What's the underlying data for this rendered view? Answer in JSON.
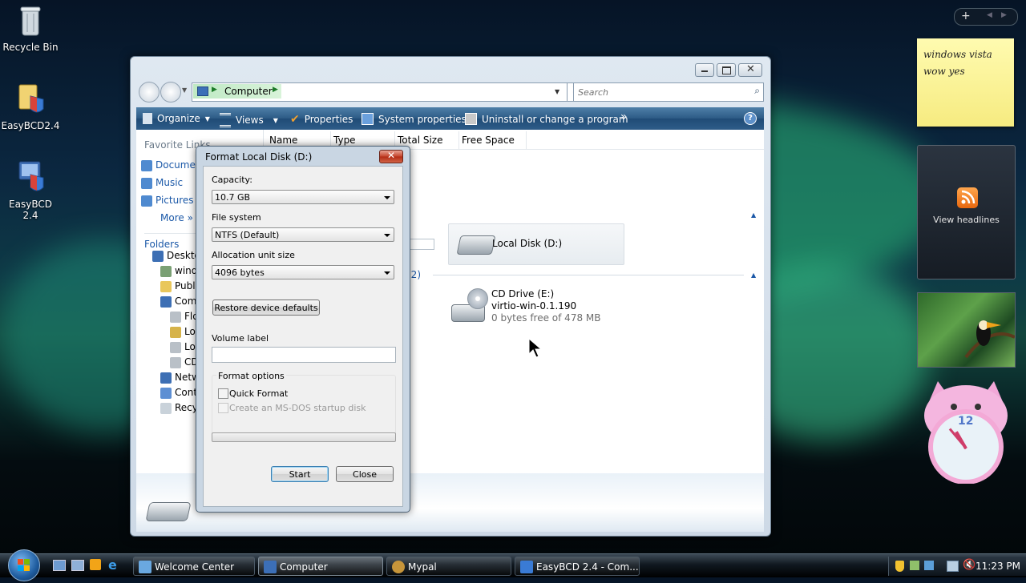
{
  "desktop": {
    "icons": [
      {
        "label": "Recycle Bin"
      },
      {
        "label": "EasyBCD2.4"
      },
      {
        "label": "EasyBCD 2.4"
      }
    ]
  },
  "explorer": {
    "breadcrumb": "Computer",
    "search_placeholder": "Search",
    "toolbar": {
      "organize": "Organize",
      "views": "Views",
      "properties": "Properties",
      "system_properties": "System properties",
      "uninstall": "Uninstall or change a program",
      "more": "»"
    },
    "columns": {
      "name": "Name",
      "type": "Type",
      "total_size": "Total Size",
      "free_space": "Free Space"
    },
    "nav": {
      "favorite_links": "Favorite Links",
      "documents": "Documents",
      "music": "Music",
      "pictures": "Pictures",
      "more": "More",
      "folders": "Folders"
    },
    "tree": [
      "Desktop",
      "windows",
      "Public",
      "Computer",
      "Floppy",
      "Local",
      "Local",
      "CD",
      "Network",
      "Control",
      "Recycle"
    ],
    "group_removable": "(2)",
    "drives": {
      "local_disk": "Local Disk (D:)",
      "cd_name": "CD Drive (E:)",
      "cd_label": "virtio-win-0.1.190",
      "cd_free": "0 bytes free of 478 MB"
    }
  },
  "dialog": {
    "title": "Format Local Disk (D:)",
    "capacity_label": "Capacity:",
    "capacity_value": "10.7 GB",
    "filesystem_label": "File system",
    "filesystem_value": "NTFS (Default)",
    "allocation_label": "Allocation unit size",
    "allocation_value": "4096 bytes",
    "restore_button": "Restore device defaults",
    "volume_label": "Volume label",
    "volume_value": "",
    "format_options": "Format options",
    "quick_format": "Quick Format",
    "quick_format_checked": false,
    "msdos_disk": "Create an MS-DOS startup disk",
    "msdos_checked": false,
    "progress": 0,
    "start_button": "Start",
    "close_button": "Close"
  },
  "gadgets": {
    "note_line1": "windows vista",
    "note_line2": "wow yes",
    "feed_label": "View headlines"
  },
  "taskbar": {
    "tasks": [
      "Welcome Center",
      "Computer",
      "Mypal",
      "EasyBCD 2.4 - Com..."
    ],
    "clock": "11:23 PM"
  },
  "colors": {
    "accent": "#2c5a85",
    "link": "#1c59a8",
    "note": "#fbf39a"
  }
}
